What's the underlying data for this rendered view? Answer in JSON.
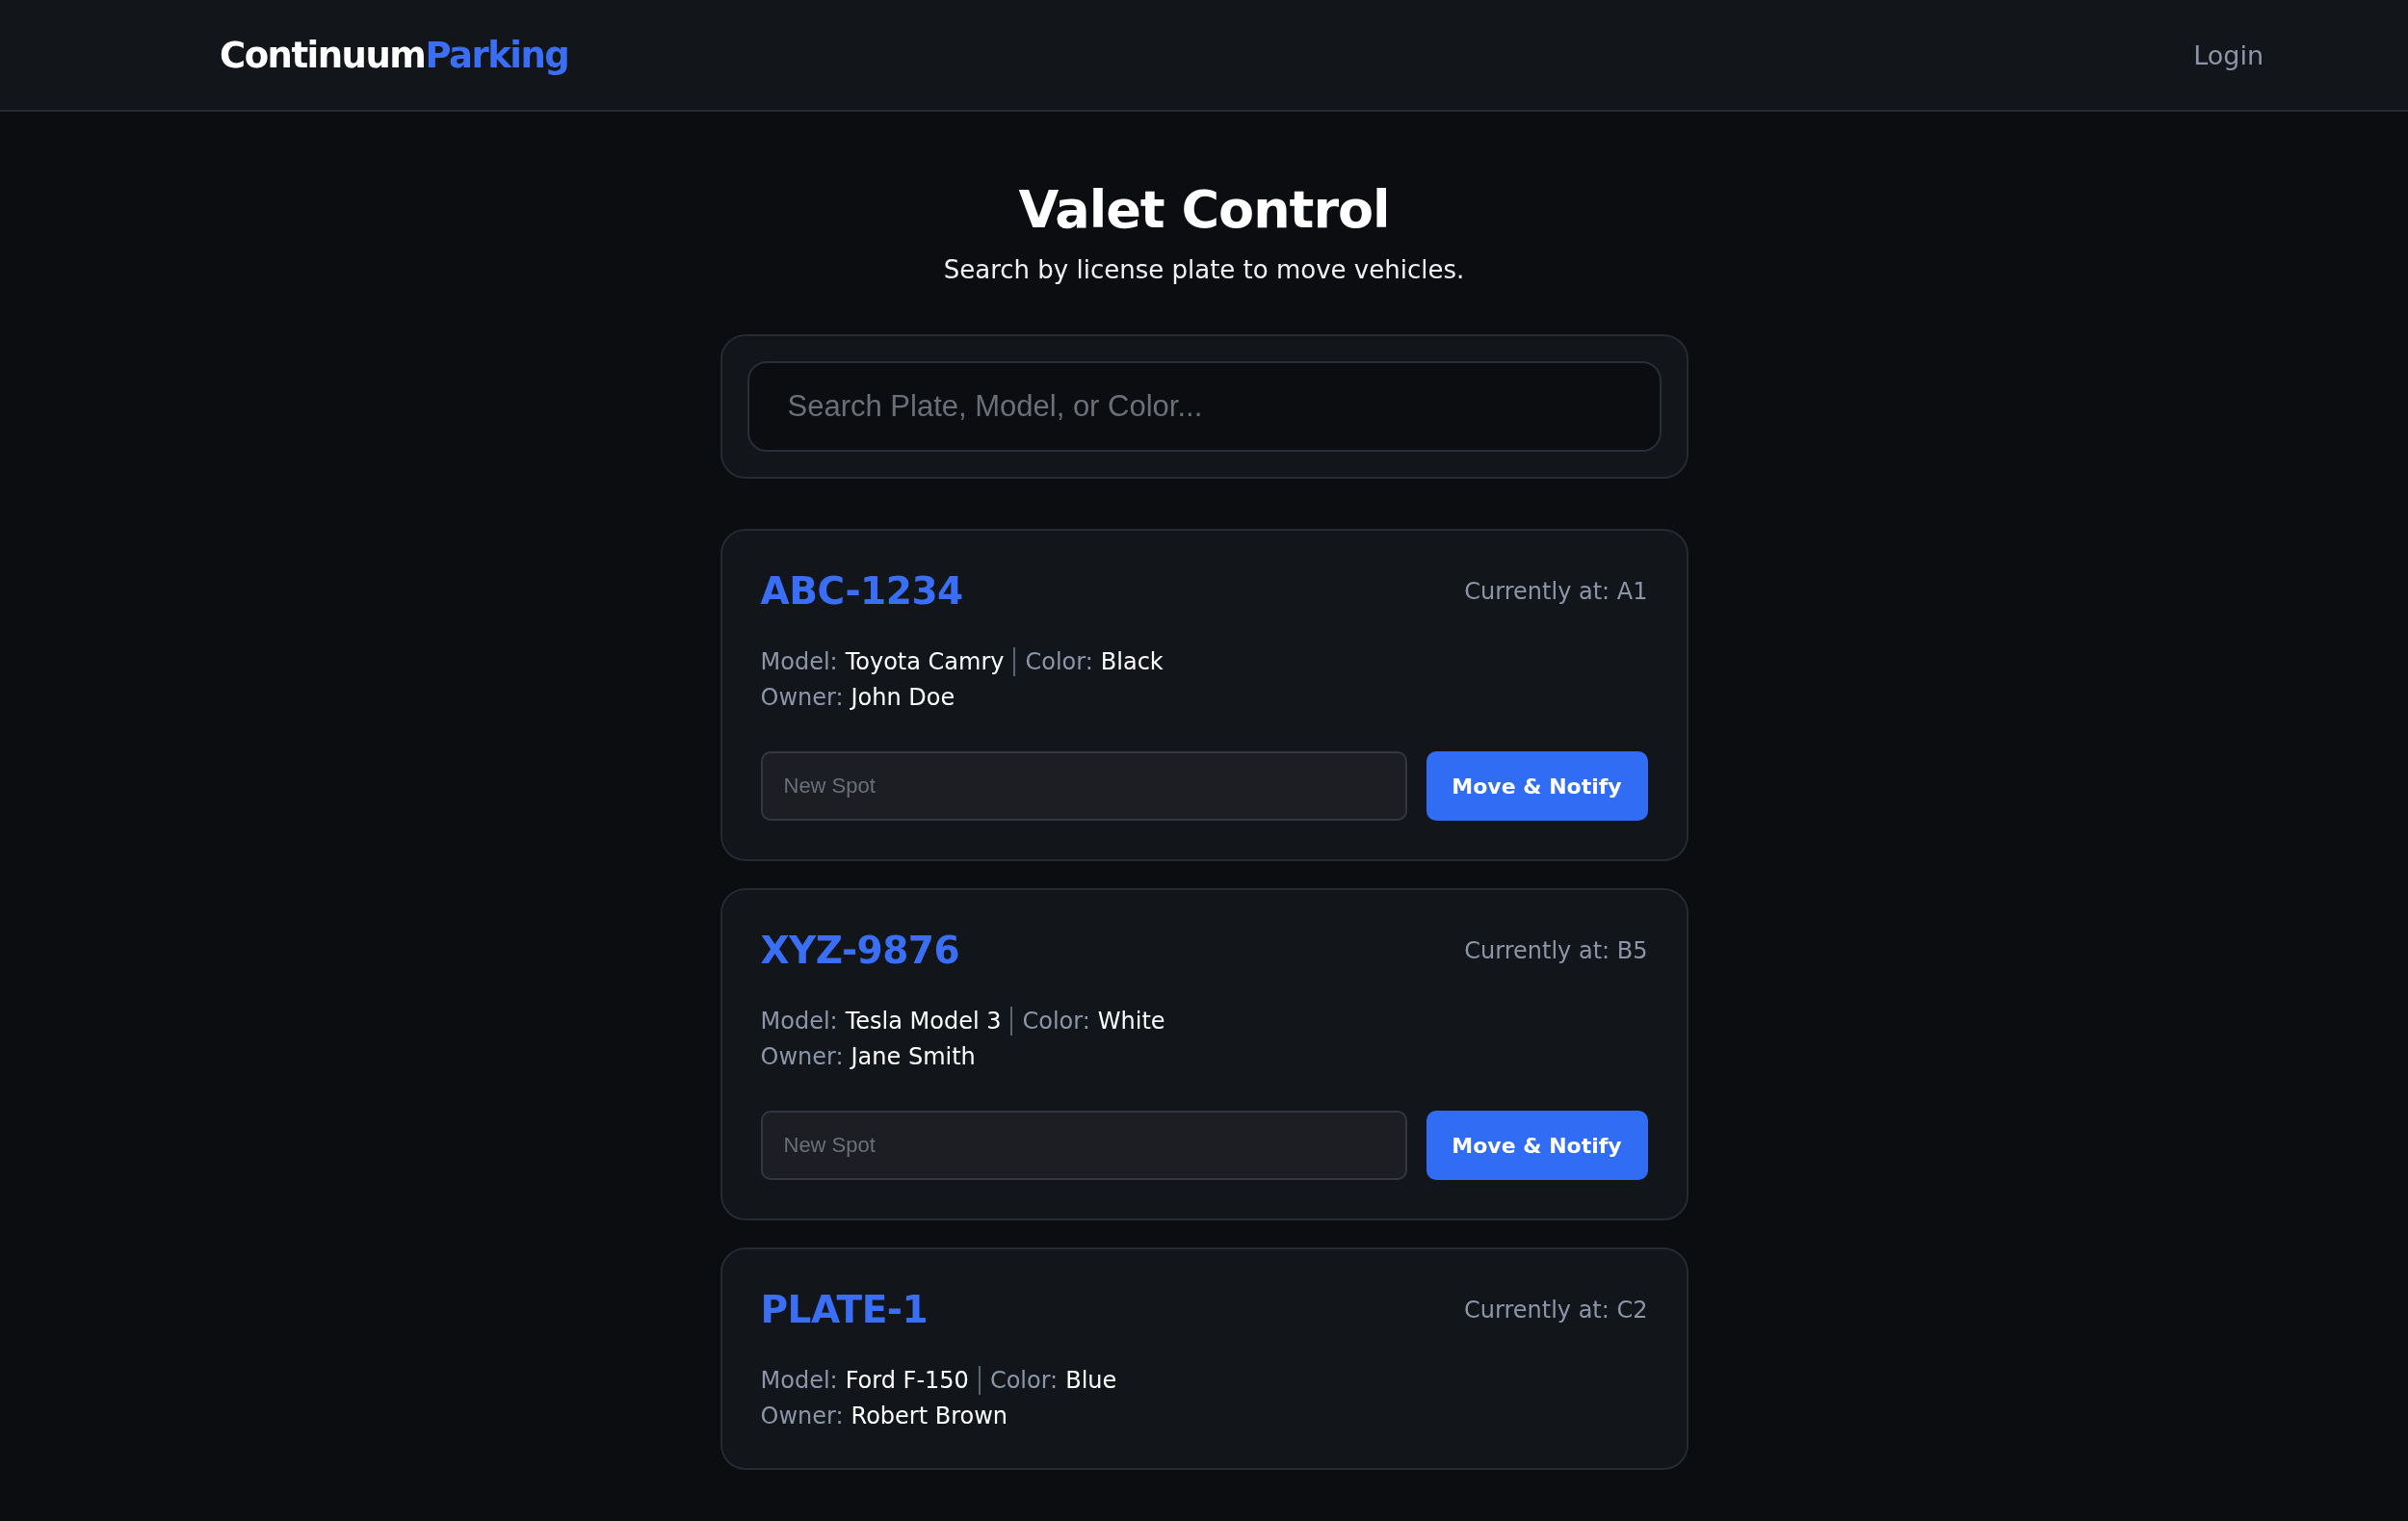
{
  "header": {
    "logo": {
      "primary": "Continuum",
      "accent": "Parking"
    },
    "login": "Login"
  },
  "page": {
    "title": "Valet Control",
    "subtitle": "Search by license plate to move vehicles."
  },
  "search": {
    "placeholder": "Search Plate, Model, or Color..."
  },
  "vehicles": [
    {
      "plate": "ABC-1234",
      "location": "Currently at: A1",
      "model_label": "Model:",
      "model": "Toyota Camry",
      "color_label": "Color:",
      "color_name": "Black",
      "owner_label": "Owner:",
      "owner": "John Doe",
      "spot_placeholder": "New Spot",
      "button": "Move & Notify"
    },
    {
      "plate": "XYZ-9876",
      "location": "Currently at: B5",
      "model_label": "Model:",
      "model": "Tesla Model 3",
      "color_label": "Color:",
      "color_name": "White",
      "owner_label": "Owner:",
      "owner": "Jane Smith",
      "spot_placeholder": "New Spot",
      "button": "Move & Notify"
    },
    {
      "plate": "PLATE-1",
      "location": "Currently at: C2",
      "model_label": "Model:",
      "model": "Ford F-150",
      "color_label": "Color:",
      "color_name": "Blue",
      "owner_label": "Owner:",
      "owner": "Robert Brown"
    }
  ]
}
